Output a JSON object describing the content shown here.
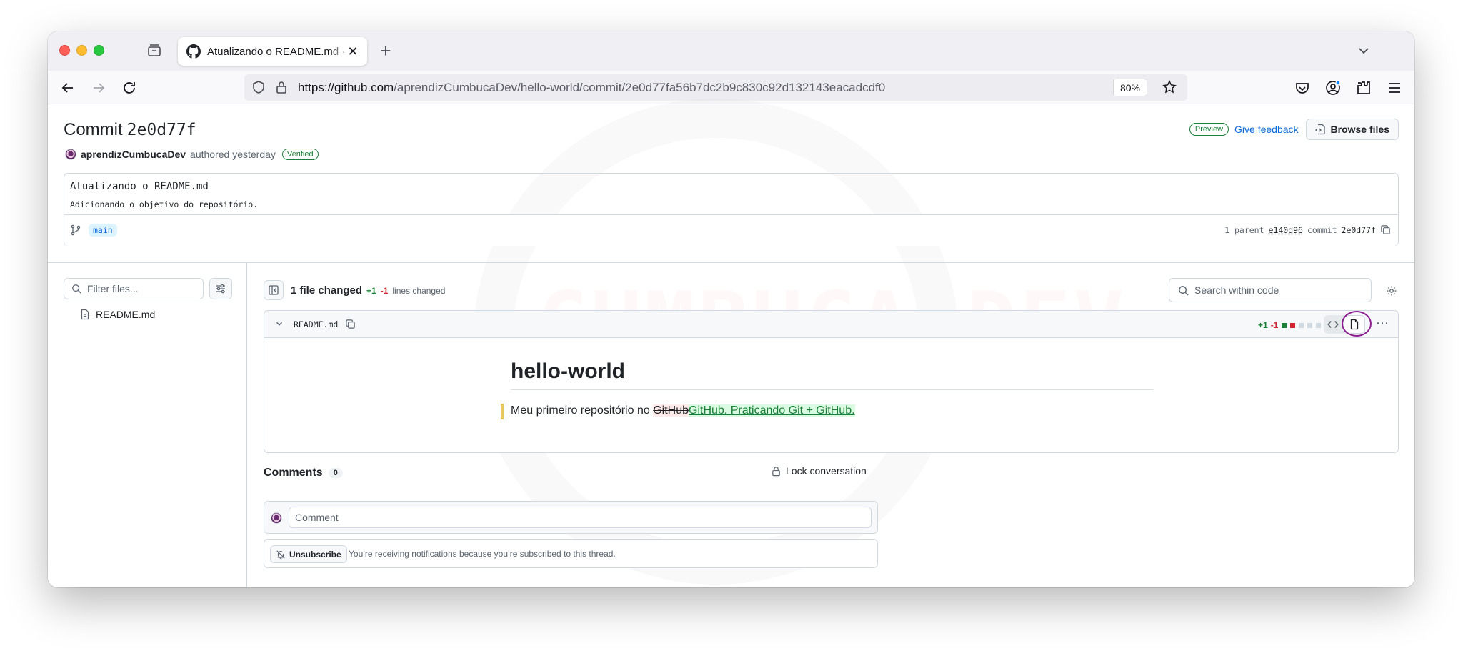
{
  "browser": {
    "tab_title": "Atualizando o README.md · aprendizCumbucaDev/hello-world",
    "url_host": "https://github.com",
    "url_path": "/aprendizCumbucaDev/hello-world/commit/2e0d77fa56b7dc2b9c830c92d132143eacadcdf0",
    "zoom": "80%"
  },
  "commit": {
    "title_label": "Commit",
    "sha_short": "2e0d77f",
    "author": "aprendizCumbucaDev",
    "authored_text": "authored yesterday",
    "verified_label": "Verified",
    "preview_label": "Preview",
    "feedback_label": "Give feedback",
    "browse_label": "Browse files",
    "message_title": "Atualizando o README.md",
    "message_body": "Adicionando o objetivo do repositório.",
    "branch": "main",
    "parent_label": "1 parent",
    "parent_sha": "e140d96",
    "commit_label": "commit",
    "commit_sha": "2e0d77f"
  },
  "sidebar": {
    "filter_placeholder": "Filter files...",
    "files": [
      {
        "name": "README.md"
      }
    ]
  },
  "diff_summary": {
    "files_changed": "1 file changed",
    "additions": "+1",
    "deletions": "-1",
    "lines_changed": "lines changed",
    "search_placeholder": "Search within code"
  },
  "diff_file": {
    "filename": "README.md",
    "additions": "+1",
    "deletions": "-1",
    "heading": "hello-world",
    "line_prefix": "Meu primeiro repositório no ",
    "removed_text": "GitHub",
    "added_text": "GitHub. Praticando Git + GitHub."
  },
  "comments": {
    "title": "Comments",
    "count": "0",
    "lock_label": "Lock conversation",
    "comment_placeholder": "Comment",
    "unsubscribe_label": "Unsubscribe",
    "notification_text": "You’re receiving notifications because you’re subscribed to this thread."
  },
  "colors": {
    "addition": "#1a7f37",
    "deletion": "#d1242f",
    "link": "#0969da",
    "highlight_ring": "#8b1d8f"
  }
}
